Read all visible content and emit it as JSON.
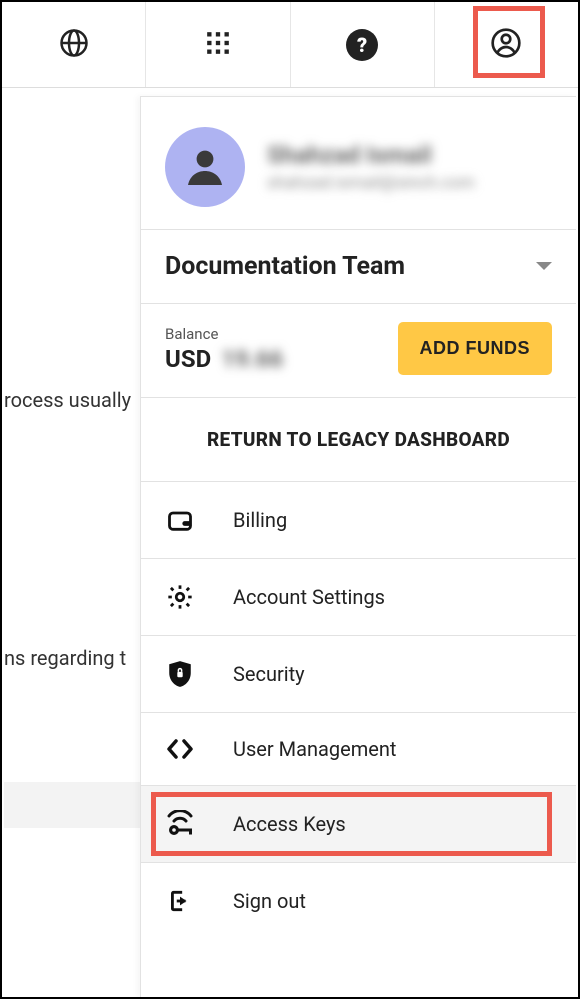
{
  "user": {
    "name": "Shahzad Ismail",
    "email": "shahzad.ismail@sinch.com"
  },
  "team": {
    "name": "Documentation Team"
  },
  "balance": {
    "label": "Balance",
    "currency": "USD",
    "amount": "19.66",
    "add_funds_label": "ADD FUNDS"
  },
  "legacy_link": "RETURN TO LEGACY DASHBOARD",
  "menu": {
    "billing": "Billing",
    "account_settings": "Account Settings",
    "security": "Security",
    "user_management": "User Management",
    "access_keys": "Access Keys",
    "sign_out": "Sign out"
  },
  "bg": {
    "line1": "rocess usually",
    "line2": "ns regarding t"
  }
}
